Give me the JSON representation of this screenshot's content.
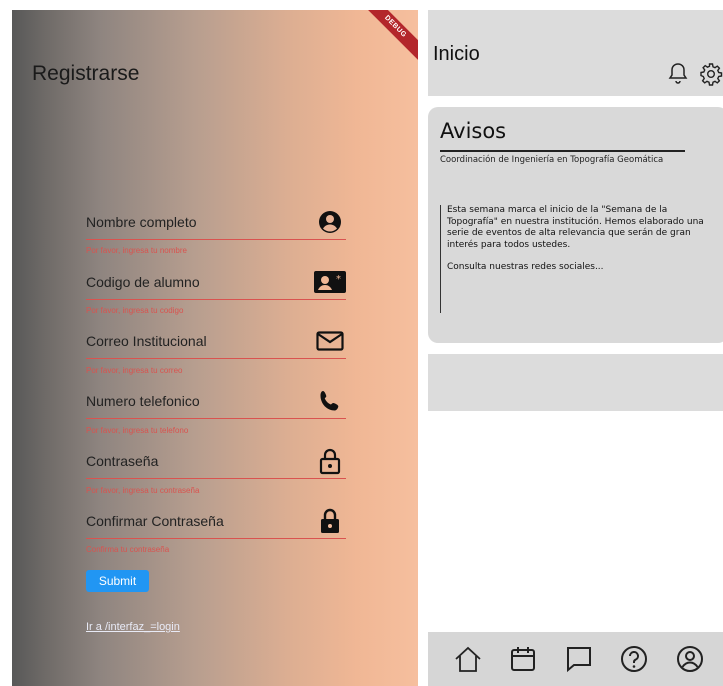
{
  "register": {
    "title": "Registrarse",
    "debug": "DEBUG",
    "fields": [
      {
        "label": "Nombre completo",
        "icon": "account-circle-icon",
        "error": "Por favor, ingresa tu nombre"
      },
      {
        "label": "Codigo de alumno",
        "icon": "badge-card-icon",
        "error": "Por favor, ingresa tu codigo"
      },
      {
        "label": "Correo Institucional",
        "icon": "mail-icon",
        "error": "Por favor, ingresa tu correo"
      },
      {
        "label": "Numero telefonico",
        "icon": "phone-icon",
        "error": "Por favor, ingresa tu telefono"
      },
      {
        "label": "Contraseña",
        "icon": "lock-open-icon",
        "error": "Por favor, ingresa tu contraseña"
      },
      {
        "label": "Confirmar Contraseña",
        "icon": "lock-icon",
        "error": "Confirma tu contraseña"
      }
    ],
    "submit_label": "Submit",
    "login_link": "Ir a /interfaz_=login",
    "colors": {
      "error": "#d9534f",
      "submit": "#2196f3"
    }
  },
  "home": {
    "title": "Inicio",
    "avisos": {
      "title": "Avisos",
      "subtitle": "Coordinación de Ingeniería en Topografía Geomática",
      "paragraph": "Esta semana marca el inicio de la \"Semana de la Topografía\" en nuestra institución. Hemos elaborado una serie de eventos de alta relevancia que serán de gran interés para todos ustedes.",
      "more": "Consulta nuestras redes sociales..."
    },
    "nav": [
      "home-icon",
      "calendar-icon",
      "chat-icon",
      "help-icon",
      "profile-icon"
    ]
  }
}
